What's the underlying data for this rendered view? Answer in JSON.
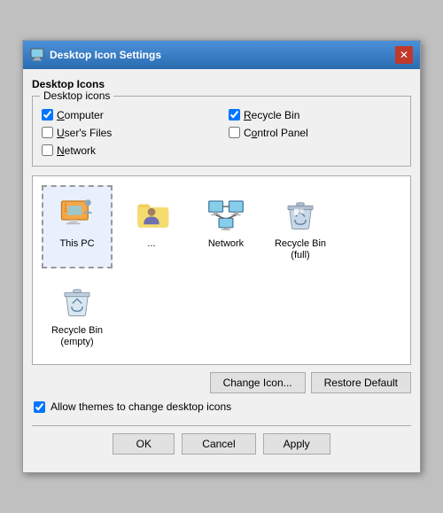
{
  "window": {
    "title": "Desktop Icon Settings",
    "close_label": "✕"
  },
  "desktop_icons_section": "Desktop Icons",
  "group": {
    "title": "Desktop icons",
    "checkboxes": [
      {
        "id": "cb-computer",
        "label": "Computer",
        "underline_char": "C",
        "checked": true,
        "col": 0
      },
      {
        "id": "cb-recycle",
        "label": "Recycle Bin",
        "underline_char": "R",
        "checked": true,
        "col": 1
      },
      {
        "id": "cb-users",
        "label": "User's Files",
        "underline_char": "U",
        "checked": false,
        "col": 0
      },
      {
        "id": "cb-control",
        "label": "Control Panel",
        "underline_char": "o",
        "checked": false,
        "col": 1
      },
      {
        "id": "cb-network",
        "label": "Network",
        "underline_char": "N",
        "checked": false,
        "col": 0
      }
    ]
  },
  "icons": [
    {
      "id": "this-pc",
      "label": "This PC",
      "selected": true
    },
    {
      "id": "users-files",
      "label": "...",
      "selected": false
    },
    {
      "id": "network",
      "label": "Network",
      "selected": false
    },
    {
      "id": "recycle-full",
      "label": "Recycle Bin\n(full)",
      "selected": false
    },
    {
      "id": "recycle-empty",
      "label": "Recycle Bin\n(empty)",
      "selected": false
    }
  ],
  "buttons": {
    "change_icon": "Change Icon...",
    "restore_default": "Restore Default"
  },
  "allow_themes": {
    "checkbox_checked": true,
    "label": "Allow themes to change desktop icons"
  },
  "footer": {
    "ok": "OK",
    "cancel": "Cancel",
    "apply": "Apply"
  }
}
